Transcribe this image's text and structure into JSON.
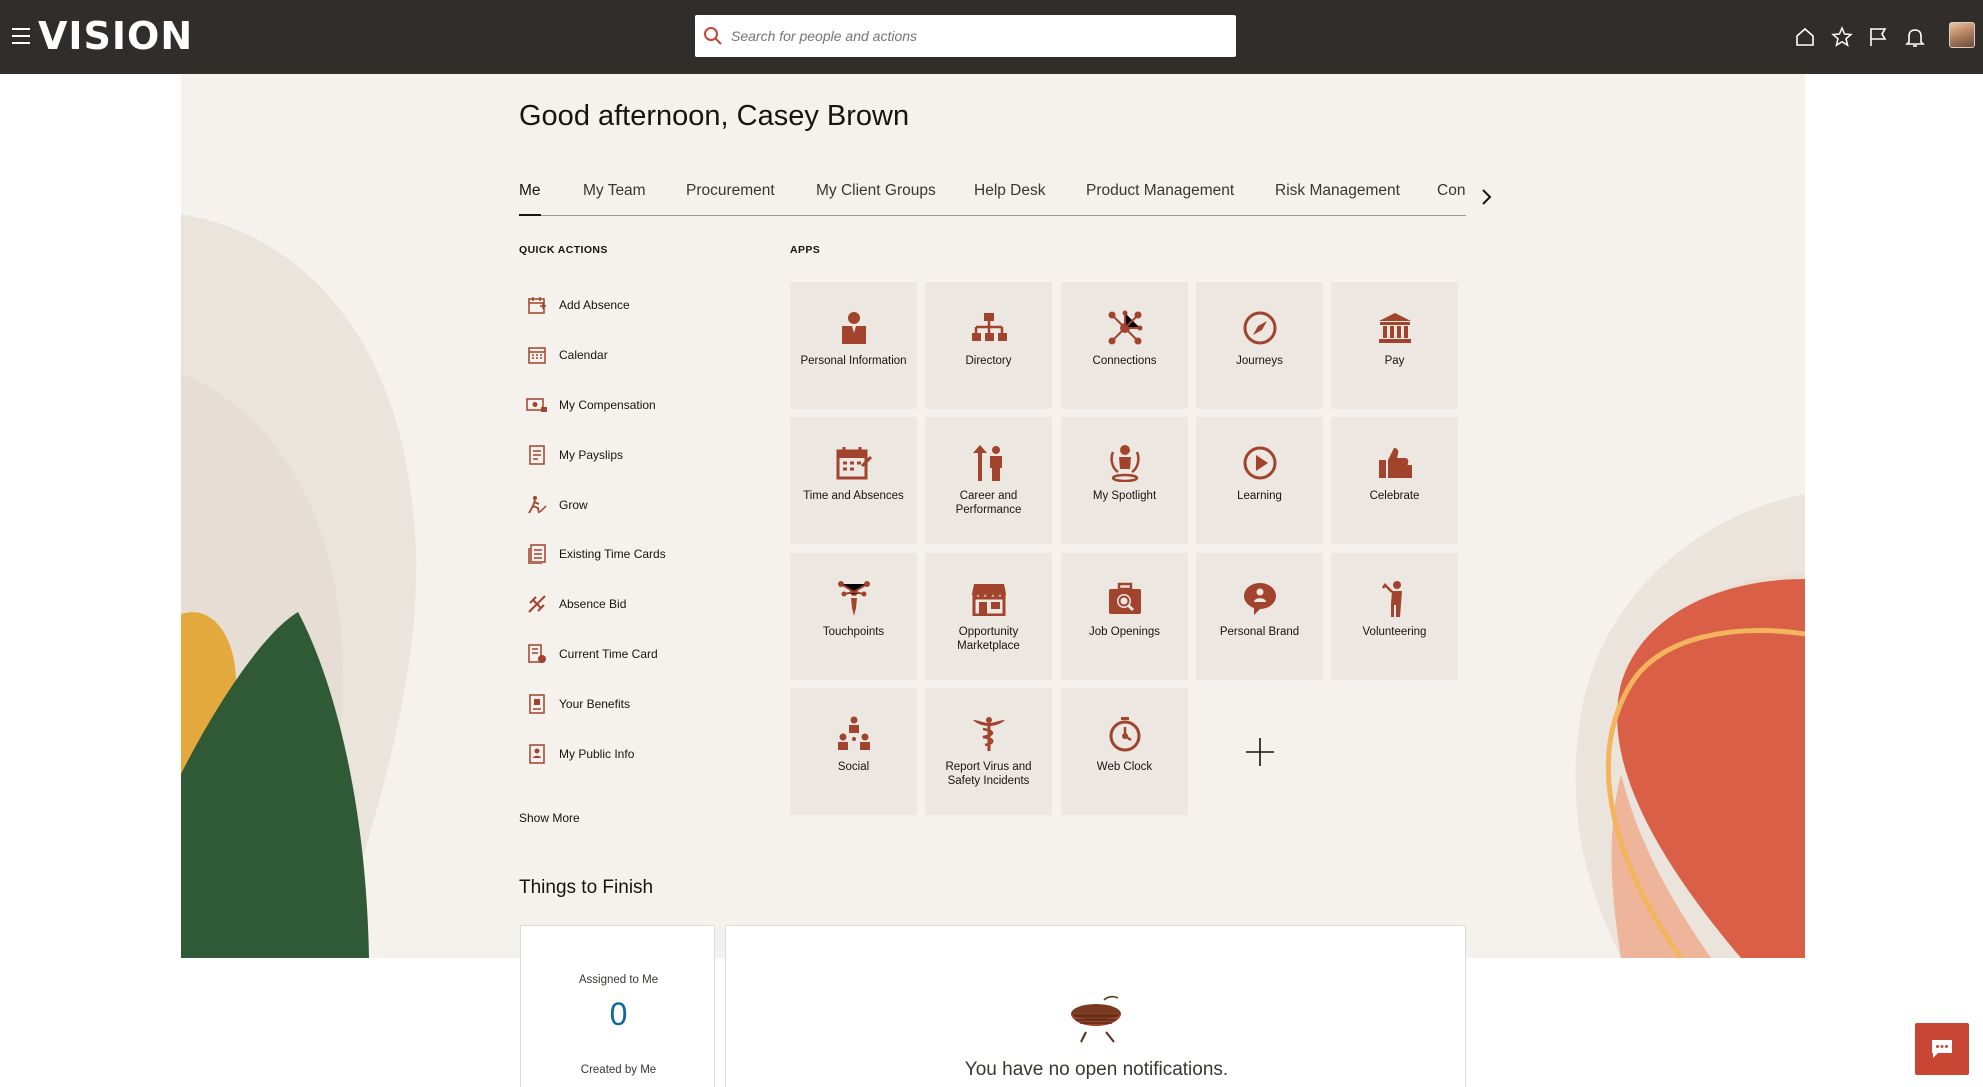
{
  "header": {
    "logo": "VISION",
    "search_placeholder": "Search for people and actions",
    "icons": [
      "menu-icon",
      "home-icon",
      "favorites-icon",
      "flag-icon",
      "notifications-icon",
      "user-avatar"
    ]
  },
  "greeting": "Good afternoon, Casey Brown",
  "tabs": [
    {
      "label": "Me",
      "active": true
    },
    {
      "label": "My Team"
    },
    {
      "label": "Procurement"
    },
    {
      "label": "My Client Groups"
    },
    {
      "label": "Help Desk"
    },
    {
      "label": "Product Management"
    },
    {
      "label": "Risk Management"
    },
    {
      "label": "Con"
    }
  ],
  "quick_actions": {
    "title": "QUICK ACTIONS",
    "items": [
      {
        "label": "Add Absence",
        "icon": "calendar-add-icon"
      },
      {
        "label": "Calendar",
        "icon": "calendar-icon"
      },
      {
        "label": "My Compensation",
        "icon": "compensation-icon"
      },
      {
        "label": "My Payslips",
        "icon": "payslip-icon"
      },
      {
        "label": "Grow",
        "icon": "grow-icon"
      },
      {
        "label": "Existing Time Cards",
        "icon": "time-cards-icon"
      },
      {
        "label": "Absence Bid",
        "icon": "absence-bid-icon"
      },
      {
        "label": "Current Time Card",
        "icon": "time-card-icon"
      },
      {
        "label": "Your Benefits",
        "icon": "benefits-icon"
      },
      {
        "label": "My Public Info",
        "icon": "public-info-icon"
      }
    ],
    "show_more": "Show More"
  },
  "apps": {
    "title": "APPS",
    "tiles": [
      {
        "label": "Personal Information",
        "icon": "person-icon"
      },
      {
        "label": "Directory",
        "icon": "org-chart-icon"
      },
      {
        "label": "Connections",
        "icon": "network-icon"
      },
      {
        "label": "Journeys",
        "icon": "compass-icon"
      },
      {
        "label": "Pay",
        "icon": "bank-icon"
      },
      {
        "label": "Time and Absences",
        "icon": "calendar-time-icon"
      },
      {
        "label": "Career and Performance",
        "icon": "career-icon"
      },
      {
        "label": "My Spotlight",
        "icon": "spotlight-icon"
      },
      {
        "label": "Learning",
        "icon": "play-circle-icon"
      },
      {
        "label": "Celebrate",
        "icon": "thumbs-up-icon"
      },
      {
        "label": "Touchpoints",
        "icon": "touchpoints-icon"
      },
      {
        "label": "Opportunity Marketplace",
        "icon": "storefront-icon"
      },
      {
        "label": "Job Openings",
        "icon": "job-search-icon"
      },
      {
        "label": "Personal Brand",
        "icon": "speech-person-icon"
      },
      {
        "label": "Volunteering",
        "icon": "volunteer-icon"
      },
      {
        "label": "Social",
        "icon": "social-group-icon"
      },
      {
        "label": "Report Virus and Safety Incidents",
        "icon": "caduceus-icon"
      },
      {
        "label": "Web Clock",
        "icon": "stopwatch-icon"
      }
    ]
  },
  "things_to_finish": {
    "title": "Things to Finish",
    "assigned_label": "Assigned to Me",
    "assigned_count": "0",
    "created_label": "Created by Me",
    "empty_message": "You have no open notifications."
  },
  "colors": {
    "header_bg": "#312d2a",
    "accent": "#c74634",
    "icon_brown": "#a1432d",
    "tile_bg": "#ede7e1",
    "hero_bg": "#f5f1ed"
  }
}
